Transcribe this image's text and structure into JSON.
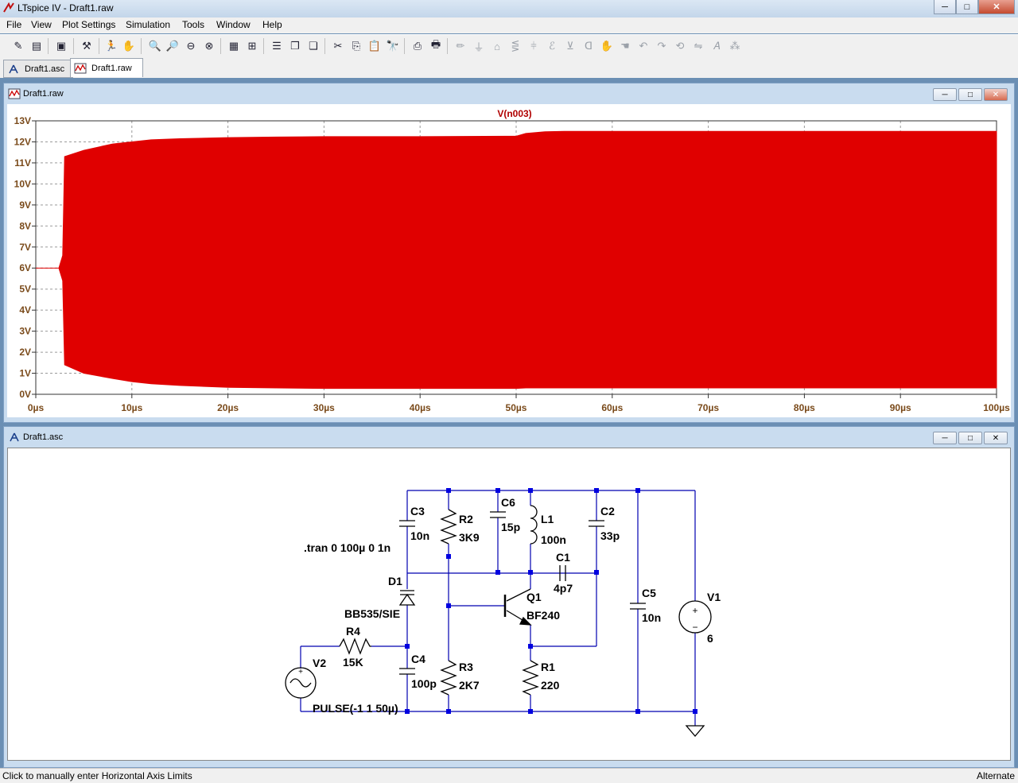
{
  "window": {
    "title": "LTspice IV - Draft1.raw",
    "minimize_label": "─",
    "maximize_label": "□",
    "close_label": "✕"
  },
  "menu": [
    "File",
    "View",
    "Plot Settings",
    "Simulation",
    "Tools",
    "Window",
    "Help"
  ],
  "tabs": [
    {
      "label": "Draft1.asc",
      "active": false
    },
    {
      "label": "Draft1.raw",
      "active": true
    }
  ],
  "plot_window": {
    "title": "Draft1.raw",
    "min_label": "─",
    "max_label": "□",
    "close_label": "✕"
  },
  "schematic_window": {
    "title": "Draft1.asc",
    "min_label": "─",
    "max_label": "□",
    "close_label": "✕"
  },
  "chart_data": {
    "type": "area",
    "title": "V(n003)",
    "series": [
      {
        "name": "V(n003)",
        "color": "#e00000"
      }
    ],
    "x_unit": "µs",
    "y_unit": "V",
    "xlim": [
      0,
      100
    ],
    "ylim": [
      0,
      13
    ],
    "x_ticks": [
      "0µs",
      "10µs",
      "20µs",
      "30µs",
      "40µs",
      "50µs",
      "60µs",
      "70µs",
      "80µs",
      "90µs",
      "100µs"
    ],
    "y_ticks": [
      "0V",
      "1V",
      "2V",
      "3V",
      "4V",
      "5V",
      "6V",
      "7V",
      "8V",
      "9V",
      "10V",
      "11V",
      "12V",
      "13V"
    ],
    "grid": true,
    "envelope": {
      "x": [
        0,
        2.4,
        2.8,
        3.0,
        5,
        8,
        10,
        12,
        15,
        20,
        25,
        30,
        40,
        50,
        51,
        53,
        55,
        100
      ],
      "upper": [
        6.0,
        6.0,
        6.6,
        11.3,
        11.6,
        11.9,
        12.0,
        12.1,
        12.15,
        12.2,
        12.23,
        12.25,
        12.25,
        12.27,
        12.4,
        12.48,
        12.5,
        12.5
      ],
      "lower": [
        6.0,
        6.0,
        5.4,
        1.4,
        1.0,
        0.75,
        0.6,
        0.5,
        0.42,
        0.33,
        0.3,
        0.28,
        0.28,
        0.28,
        0.3,
        0.3,
        0.3,
        0.3
      ]
    }
  },
  "schematic": {
    "directive": ".tran 0 100µ 0 1n",
    "components": {
      "C3": {
        "name": "C3",
        "value": "10n"
      },
      "R2": {
        "name": "R2",
        "value": "3K9"
      },
      "C6": {
        "name": "C6",
        "value": "15p"
      },
      "L1": {
        "name": "L1",
        "value": "100n"
      },
      "C2": {
        "name": "C2",
        "value": "33p"
      },
      "C1": {
        "name": "C1",
        "value": "4p7"
      },
      "D1": {
        "name": "D1",
        "value": "BB535/SIE"
      },
      "Q1": {
        "name": "Q1",
        "value": "BF240"
      },
      "C5": {
        "name": "C5",
        "value": "10n"
      },
      "V1": {
        "name": "V1",
        "value": "6"
      },
      "R4": {
        "name": "R4",
        "value": "15K"
      },
      "C4": {
        "name": "C4",
        "value": "100p"
      },
      "R3": {
        "name": "R3",
        "value": "2K7"
      },
      "R1": {
        "name": "R1",
        "value": "220"
      },
      "V2": {
        "name": "V2",
        "value": "PULSE(-1 1 50µ)"
      }
    }
  },
  "status": {
    "left": "Click to manually enter Horizontal Axis Limits",
    "right": "Alternate"
  }
}
